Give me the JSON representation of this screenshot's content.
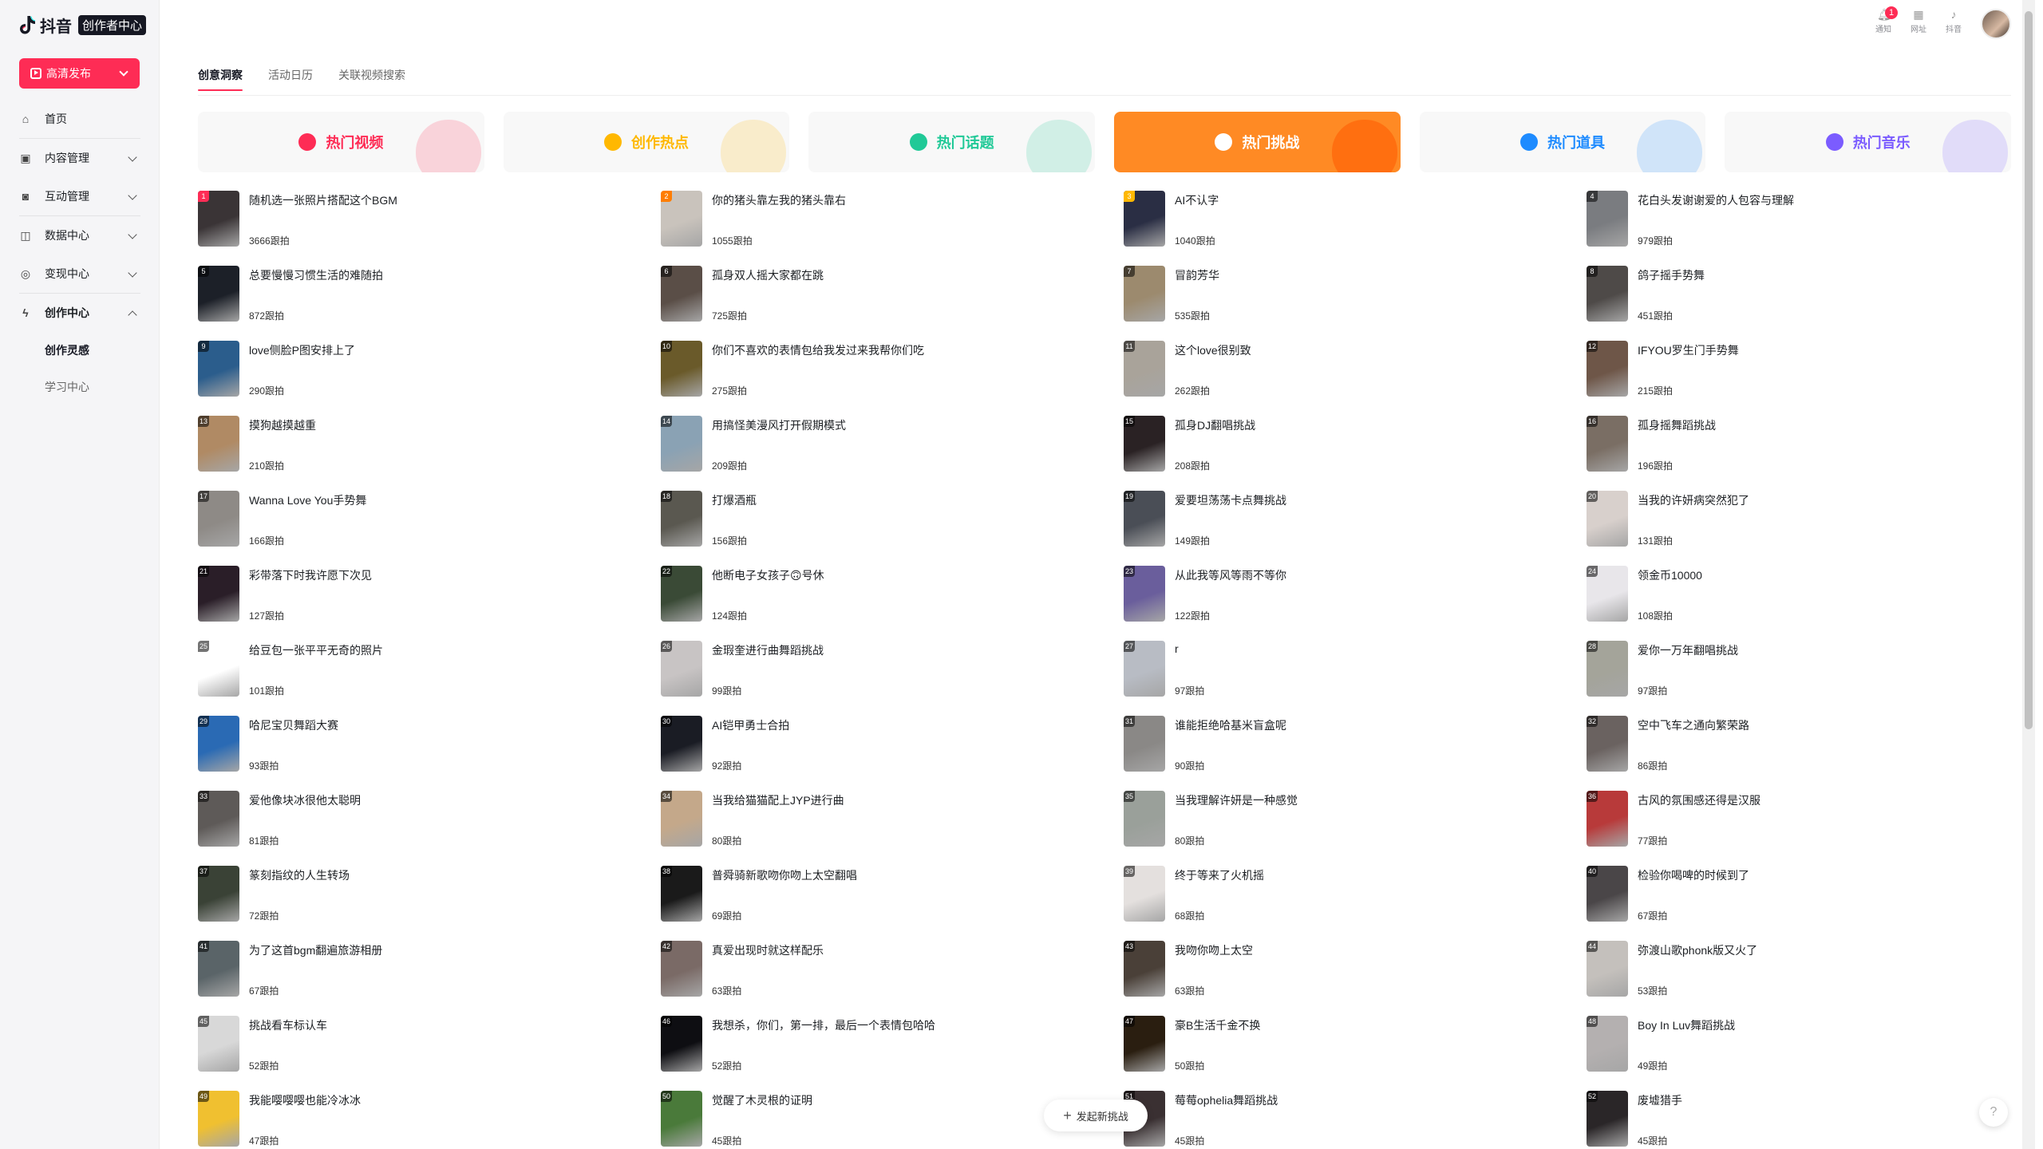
{
  "sidebar": {
    "logo_text": "抖音",
    "logo_badge": "创作者中心",
    "publish_label": "高清发布",
    "nav": [
      {
        "label": "首页",
        "icon": "home-icon"
      },
      {
        "label": "内容管理",
        "icon": "content-icon"
      },
      {
        "label": "互动管理",
        "icon": "interaction-icon"
      },
      {
        "label": "数据中心",
        "icon": "data-icon"
      },
      {
        "label": "变现中心",
        "icon": "monetize-icon"
      },
      {
        "label": "创作中心",
        "icon": "create-icon"
      }
    ],
    "sub": [
      {
        "label": "创作灵感"
      },
      {
        "label": "学习中心"
      }
    ]
  },
  "topbar": {
    "notify": "通知",
    "notify_badge": "1",
    "web": "网址",
    "douyin": "抖音"
  },
  "tabs": [
    {
      "label": "创意洞察"
    },
    {
      "label": "活动日历"
    },
    {
      "label": "关联视频搜索"
    }
  ],
  "categories": [
    {
      "label": "热门视频",
      "color": "#fe2c55",
      "bg": "#f8f8f8",
      "icon": "flame-icon"
    },
    {
      "label": "创作热点",
      "color": "#ffb800",
      "bg": "#f8f8f8",
      "icon": "bulb-icon"
    },
    {
      "label": "热门话题",
      "color": "#20c997",
      "bg": "#f8f8f8",
      "icon": "hashtag-icon"
    },
    {
      "label": "热门挑战",
      "color": "#ffffff",
      "bg": "#ff8a24",
      "icon": "star-icon"
    },
    {
      "label": "热门道具",
      "color": "#1e8bff",
      "bg": "#f8f8f8",
      "icon": "wand-icon"
    },
    {
      "label": "热门音乐",
      "color": "#7b5cff",
      "bg": "#f8f8f8",
      "icon": "music-icon"
    }
  ],
  "items": [
    {
      "rank": "1",
      "name": "随机选一张照片搭配这个BGM",
      "count": "3666跟拍",
      "color": "#3a3436"
    },
    {
      "rank": "2",
      "name": "你的猪头靠左我的猪头靠右",
      "count": "1055跟拍",
      "color": "#c9c3bc"
    },
    {
      "rank": "3",
      "name": "AI不认字",
      "count": "1040跟拍",
      "color": "#2a2e44"
    },
    {
      "rank": "4",
      "name": "花白头发谢谢爱的人包容与理解",
      "count": "979跟拍",
      "color": "#7a7c80"
    },
    {
      "rank": "5",
      "name": "总要慢慢习惯生活的难随拍",
      "count": "872跟拍",
      "color": "#1c2028"
    },
    {
      "rank": "6",
      "name": "孤身双人摇大家都在跳",
      "count": "725跟拍",
      "color": "#5a4e47"
    },
    {
      "rank": "7",
      "name": "冒韵芳华",
      "count": "535跟拍",
      "color": "#9c8a6e"
    },
    {
      "rank": "8",
      "name": "鸽子摇手势舞",
      "count": "451跟拍",
      "color": "#4e4a48"
    },
    {
      "rank": "9",
      "name": "love侧脸P图安排上了",
      "count": "290跟拍",
      "color": "#2b5d8c"
    },
    {
      "rank": "10",
      "name": "你们不喜欢的表情包给我发过来我帮你们吃",
      "count": "275跟拍",
      "color": "#6a5a2a"
    },
    {
      "rank": "11",
      "name": "这个love很别致",
      "count": "262跟拍",
      "color": "#a9a39a"
    },
    {
      "rank": "12",
      "name": "IFYOU罗生门手势舞",
      "count": "215跟拍",
      "color": "#6e5648"
    },
    {
      "rank": "13",
      "name": "摸狗越摸越重",
      "count": "210跟拍",
      "color": "#b08a64"
    },
    {
      "rank": "14",
      "name": "用搞怪美漫风打开假期模式",
      "count": "209跟拍",
      "color": "#8aa2b4"
    },
    {
      "rank": "15",
      "name": "孤身DJ翻唱挑战",
      "count": "208跟拍",
      "color": "#2a2224"
    },
    {
      "rank": "16",
      "name": "孤身摇舞蹈挑战",
      "count": "196跟拍",
      "color": "#7a6e64"
    },
    {
      "rank": "17",
      "name": "Wanna Love You手势舞",
      "count": "166跟拍",
      "color": "#8e8a86"
    },
    {
      "rank": "18",
      "name": "打爆酒瓶",
      "count": "156跟拍",
      "color": "#5a5850"
    },
    {
      "rank": "19",
      "name": "爱要坦荡荡卡点舞挑战",
      "count": "149跟拍",
      "color": "#4a4e56"
    },
    {
      "rank": "20",
      "name": "当我的许妍病突然犯了",
      "count": "131跟拍",
      "color": "#d8d0cc"
    },
    {
      "rank": "21",
      "name": "彩带落下时我许愿下次见",
      "count": "127跟拍",
      "color": "#2a1e28"
    },
    {
      "rank": "22",
      "name": "他断电子女孩子🙃号休",
      "count": "124跟拍",
      "color": "#3a4a36"
    },
    {
      "rank": "23",
      "name": "从此我等风等雨不等你",
      "count": "122跟拍",
      "color": "#6a5e9c"
    },
    {
      "rank": "24",
      "name": "领金币10000",
      "count": "108跟拍",
      "color": "#e8e6ea"
    },
    {
      "rank": "25",
      "name": "给豆包一张平平无奇的照片",
      "count": "101跟拍",
      "color": "#ffffff"
    },
    {
      "rank": "26",
      "name": "金瑕奎进行曲舞蹈挑战",
      "count": "99跟拍",
      "color": "#c8c4c4"
    },
    {
      "rank": "27",
      "name": "r",
      "count": "97跟拍",
      "color": "#b8bcc4"
    },
    {
      "rank": "28",
      "name": "爱你一万年翻唱挑战",
      "count": "97跟拍",
      "color": "#a4a49a"
    },
    {
      "rank": "29",
      "name": "哈尼宝贝舞蹈大赛",
      "count": "93跟拍",
      "color": "#2a6ab4"
    },
    {
      "rank": "30",
      "name": "AI铠甲勇士合拍",
      "count": "92跟拍",
      "color": "#1a1c24"
    },
    {
      "rank": "31",
      "name": "谁能拒绝哈基米盲盒呢",
      "count": "90跟拍",
      "color": "#8a8886"
    },
    {
      "rank": "32",
      "name": "空中飞车之通向繁荣路",
      "count": "86跟拍",
      "color": "#6a6260"
    },
    {
      "rank": "33",
      "name": "爱他像块冰很他太聪明",
      "count": "81跟拍",
      "color": "#5e5a58"
    },
    {
      "rank": "34",
      "name": "当我给猫猫配上JYP进行曲",
      "count": "80跟拍",
      "color": "#c4a88a"
    },
    {
      "rank": "35",
      "name": "当我理解许妍是一种感觉",
      "count": "80跟拍",
      "color": "#9aa09a"
    },
    {
      "rank": "36",
      "name": "古风的氛围感还得是汉服",
      "count": "77跟拍",
      "color": "#b83a3a"
    },
    {
      "rank": "37",
      "name": "篆刻指纹的人生转场",
      "count": "72跟拍",
      "color": "#3a4236"
    },
    {
      "rank": "38",
      "name": "普舜骑新歌吻你吻上太空翻唱",
      "count": "69跟拍",
      "color": "#1a1a1a"
    },
    {
      "rank": "39",
      "name": "终于等来了火机摇",
      "count": "68跟拍",
      "color": "#e4e0de"
    },
    {
      "rank": "40",
      "name": "检验你喝啤的时候到了",
      "count": "67跟拍",
      "color": "#4a4648"
    },
    {
      "rank": "41",
      "name": "为了这首bgm翻遍旅游相册",
      "count": "67跟拍",
      "color": "#5a6468"
    },
    {
      "rank": "42",
      "name": "真爱出现时就这样配乐",
      "count": "63跟拍",
      "color": "#7a6a66"
    },
    {
      "rank": "43",
      "name": "我吻你吻上太空",
      "count": "63跟拍",
      "color": "#4a4038"
    },
    {
      "rank": "44",
      "name": "弥渡山歌phonk版又火了",
      "count": "53跟拍",
      "color": "#c4c0bc"
    },
    {
      "rank": "45",
      "name": "挑战看车标认车",
      "count": "52跟拍",
      "color": "#d8d8d8"
    },
    {
      "rank": "46",
      "name": "我想杀，你们，第一排，最后一个表情包哈哈",
      "count": "52跟拍",
      "color": "#0e0e12"
    },
    {
      "rank": "47",
      "name": "豪B生活千金不换",
      "count": "50跟拍",
      "color": "#2a1e10"
    },
    {
      "rank": "48",
      "name": "Boy In Luv舞蹈挑战",
      "count": "49跟拍",
      "color": "#b4b0b0"
    },
    {
      "rank": "49",
      "name": "我能嘤嘤嘤也能冷冰冰",
      "count": "47跟拍",
      "color": "#f0c030"
    },
    {
      "rank": "50",
      "name": "觉醒了木灵根的证明",
      "count": "45跟拍",
      "color": "#4a7a3a"
    },
    {
      "rank": "51",
      "name": "莓莓ophelia舞蹈挑战",
      "count": "45跟拍",
      "color": "#3a3032"
    },
    {
      "rank": "52",
      "name": "废墟猎手",
      "count": "45跟拍",
      "color": "#2a2628"
    }
  ],
  "float_button": "发起新挑战",
  "help": "?"
}
